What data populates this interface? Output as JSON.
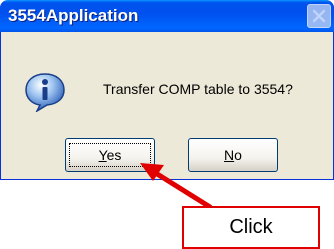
{
  "dialog": {
    "title": "3554Application",
    "message": "Transfer COMP table to 3554?",
    "icon": "info-icon",
    "buttons": {
      "yes": {
        "mnemonic": "Y",
        "rest": "es"
      },
      "no": {
        "mnemonic": "N",
        "rest": "o"
      }
    }
  },
  "annotation": {
    "label": "Click",
    "color": "#e00000"
  },
  "colors": {
    "titlebar": "#0053ee",
    "dialog_bg": "#ece9d8"
  }
}
